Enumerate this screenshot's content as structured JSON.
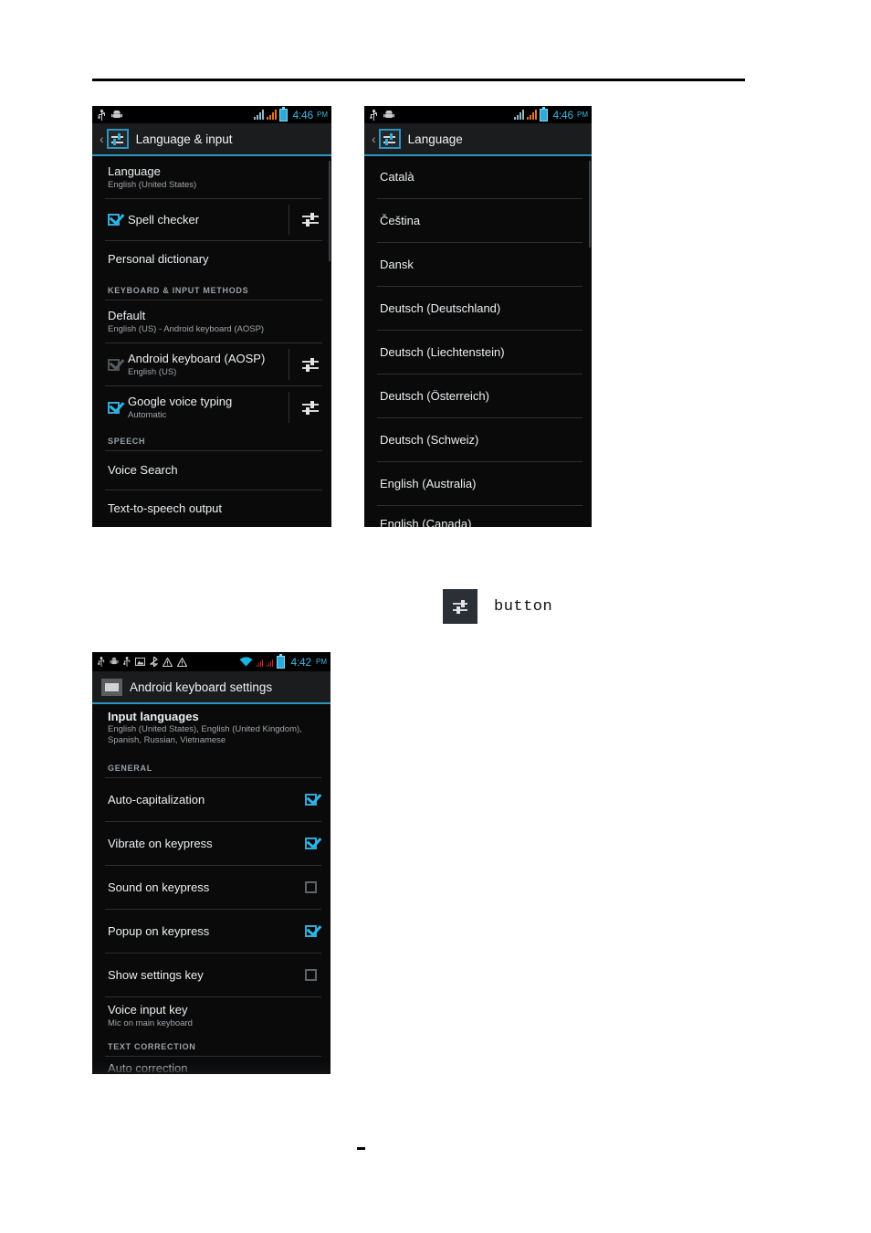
{
  "page": {
    "rule": "horizontal-rule",
    "footer_mark": ""
  },
  "legend": {
    "icon": "sliders-settings-icon",
    "label": "button"
  },
  "screens": [
    {
      "id": "language-and-input",
      "status_bar": {
        "left_icons": [
          "usb-icon",
          "android-robot-icon"
        ],
        "right_icons": [
          "signal-bars-white-icon",
          "signal-bars-orange-icon",
          "battery-icon"
        ],
        "time": "4:46",
        "ampm": "PM"
      },
      "action_bar": {
        "back": "‹",
        "icon": "settings-sliders-app-icon",
        "title": "Language & input"
      },
      "rows": [
        {
          "kind": "plain",
          "title": "Language",
          "sub": "English (United States)"
        },
        {
          "kind": "check",
          "title": "Spell checker",
          "sub": "",
          "checked": true,
          "dim": false,
          "gear": true
        },
        {
          "kind": "plain",
          "title": "Personal dictionary",
          "sub": ""
        },
        {
          "kind": "section",
          "title": "KEYBOARD & INPUT METHODS"
        },
        {
          "kind": "plain",
          "title": "Default",
          "sub": "English (US) - Android keyboard (AOSP)"
        },
        {
          "kind": "check",
          "title": "Android keyboard (AOSP)",
          "sub": "English (US)",
          "checked": true,
          "dim": true,
          "gear": true
        },
        {
          "kind": "check",
          "title": "Google voice typing",
          "sub": "Automatic",
          "checked": true,
          "dim": false,
          "gear": true
        },
        {
          "kind": "section",
          "title": "SPEECH"
        },
        {
          "kind": "plain",
          "title": "Voice Search",
          "sub": ""
        },
        {
          "kind": "plain",
          "title": "Text-to-speech output",
          "sub": ""
        }
      ]
    },
    {
      "id": "language-list",
      "status_bar": {
        "left_icons": [
          "usb-icon",
          "android-robot-icon"
        ],
        "right_icons": [
          "signal-bars-white-icon",
          "signal-bars-orange-icon",
          "battery-icon"
        ],
        "time": "4:46",
        "ampm": "PM"
      },
      "action_bar": {
        "back": "‹",
        "icon": "settings-sliders-app-icon",
        "title": "Language"
      },
      "rows": [
        {
          "kind": "plain",
          "title": "Català",
          "sub": ""
        },
        {
          "kind": "plain",
          "title": "Čeština",
          "sub": ""
        },
        {
          "kind": "plain",
          "title": "Dansk",
          "sub": ""
        },
        {
          "kind": "plain",
          "title": "Deutsch (Deutschland)",
          "sub": ""
        },
        {
          "kind": "plain",
          "title": "Deutsch (Liechtenstein)",
          "sub": ""
        },
        {
          "kind": "plain",
          "title": "Deutsch (Österreich)",
          "sub": ""
        },
        {
          "kind": "plain",
          "title": "Deutsch (Schweiz)",
          "sub": ""
        },
        {
          "kind": "plain",
          "title": "English (Australia)",
          "sub": ""
        },
        {
          "kind": "plain",
          "title": "English (Canada)",
          "sub": ""
        }
      ]
    },
    {
      "id": "android-keyboard-settings",
      "status_bar": {
        "left_icons": [
          "usb-icon",
          "android-robot-icon",
          "usb-icon",
          "image-icon",
          "bluetooth-icon",
          "warning-triangle-icon",
          "warning-triangle-icon"
        ],
        "right_icons": [
          "wifi-icon",
          "signal-bars-red-icon",
          "signal-bars-red-icon",
          "battery-icon"
        ],
        "time": "4:42",
        "ampm": "PM"
      },
      "action_bar": {
        "back": "",
        "icon": "keyboard-app-icon",
        "title": "Android keyboard settings"
      },
      "rows": [
        {
          "kind": "plain",
          "title": "Input languages",
          "sub": "English (United States), English (United Kingdom), Spanish, Russian, Vietnamese"
        },
        {
          "kind": "section",
          "title": "GENERAL"
        },
        {
          "kind": "toggle",
          "title": "Auto-capitalization",
          "sub": "",
          "checked": true
        },
        {
          "kind": "toggle",
          "title": "Vibrate on keypress",
          "sub": "",
          "checked": true
        },
        {
          "kind": "toggle",
          "title": "Sound on keypress",
          "sub": "",
          "checked": false
        },
        {
          "kind": "toggle",
          "title": "Popup on keypress",
          "sub": "",
          "checked": true
        },
        {
          "kind": "toggle",
          "title": "Show settings key",
          "sub": "",
          "checked": false
        },
        {
          "kind": "plain",
          "title": "Voice input key",
          "sub": "Mic on main keyboard"
        },
        {
          "kind": "section",
          "title": "TEXT CORRECTION"
        },
        {
          "kind": "plain",
          "title": "Auto correction",
          "sub": ""
        }
      ]
    }
  ]
}
